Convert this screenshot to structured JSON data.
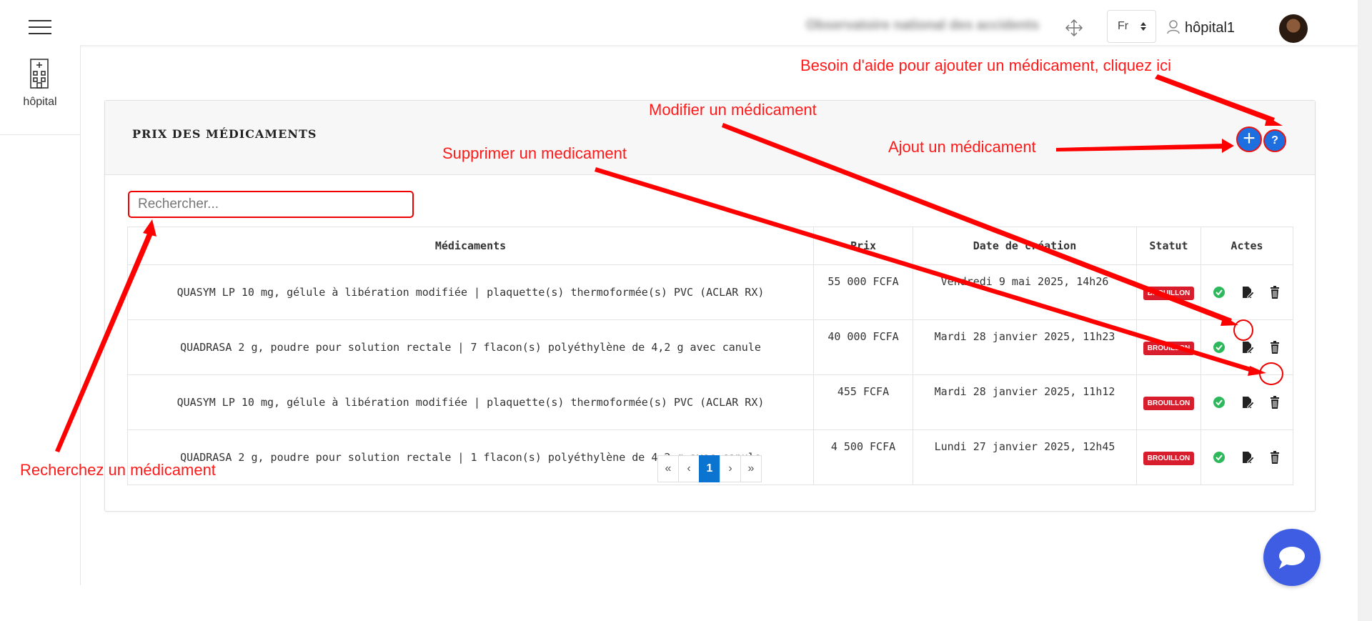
{
  "header": {
    "org_name": "Observatoire national des accidents",
    "language": "Fr",
    "user_name": "hôpital1"
  },
  "sidebar": {
    "items": [
      {
        "label": "hôpital",
        "icon": "hospital-icon"
      }
    ]
  },
  "card": {
    "title": "PRIX DES MÉDICAMENTS",
    "add_label": "+",
    "help_label": "?"
  },
  "search": {
    "placeholder": "Rechercher..."
  },
  "table": {
    "columns": [
      "Médicaments",
      "Prix",
      "Date de création",
      "Statut",
      "Actes"
    ],
    "rows": [
      {
        "medicament": "QUASYM LP 10 mg, gélule à libération modifiée | plaquette(s) thermoformée(s) PVC (ACLAR RX)",
        "prix": "55 000 FCFA",
        "date": "Vendredi 9 mai 2025, 14h26",
        "statut": "BROUILLON"
      },
      {
        "medicament": "QUADRASA 2 g, poudre pour solution rectale | 7 flacon(s) polyéthylène de 4,2 g avec canule",
        "prix": "40 000 FCFA",
        "date": "Mardi 28 janvier 2025, 11h23",
        "statut": "BROUILLON"
      },
      {
        "medicament": "QUASYM LP 10 mg, gélule à libération modifiée | plaquette(s) thermoformée(s) PVC (ACLAR RX)",
        "prix": "455 FCFA",
        "date": "Mardi 28 janvier 2025, 11h12",
        "statut": "BROUILLON"
      },
      {
        "medicament": "QUADRASA 2 g, poudre pour solution rectale | 1 flacon(s) polyéthylène de 4,2 g avec canule",
        "prix": "4 500 FCFA",
        "date": "Lundi 27 janvier 2025, 12h45",
        "statut": "BROUILLON"
      }
    ]
  },
  "pagination": {
    "first": "«",
    "prev": "‹",
    "current": "1",
    "next": "›",
    "last": "»"
  },
  "annotations": {
    "help": "Besoin d'aide pour ajouter un médicament, cliquez ici",
    "edit": "Modifier un médicament",
    "delete": "Supprimer un medicament",
    "add": "Ajout un médicament",
    "search": "Recherchez un médicament"
  },
  "colors": {
    "primary": "#1d6fe0",
    "annotation_red": "#ff1a1a",
    "badge_red": "#d81e2c",
    "pager_active": "#0b74d1",
    "chat": "#3f5de3"
  }
}
